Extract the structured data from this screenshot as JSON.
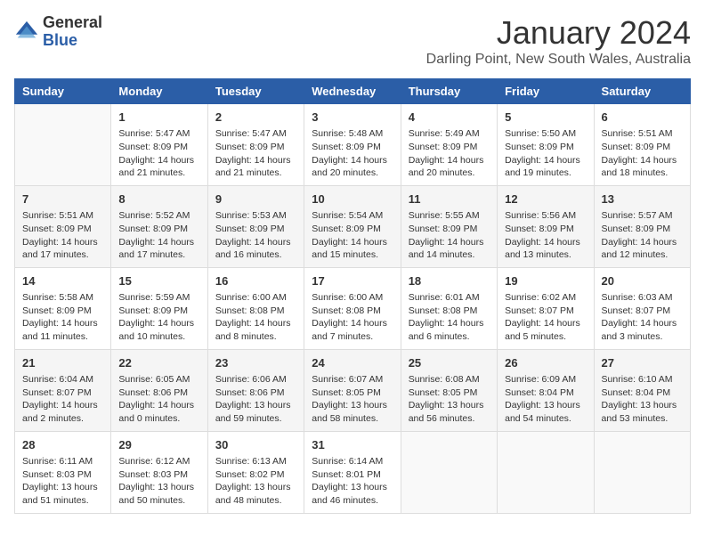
{
  "logo": {
    "general": "General",
    "blue": "Blue"
  },
  "title": "January 2024",
  "location": "Darling Point, New South Wales, Australia",
  "weekdays": [
    "Sunday",
    "Monday",
    "Tuesday",
    "Wednesday",
    "Thursday",
    "Friday",
    "Saturday"
  ],
  "weeks": [
    [
      {
        "day": "",
        "info": ""
      },
      {
        "day": "1",
        "info": "Sunrise: 5:47 AM\nSunset: 8:09 PM\nDaylight: 14 hours\nand 21 minutes."
      },
      {
        "day": "2",
        "info": "Sunrise: 5:47 AM\nSunset: 8:09 PM\nDaylight: 14 hours\nand 21 minutes."
      },
      {
        "day": "3",
        "info": "Sunrise: 5:48 AM\nSunset: 8:09 PM\nDaylight: 14 hours\nand 20 minutes."
      },
      {
        "day": "4",
        "info": "Sunrise: 5:49 AM\nSunset: 8:09 PM\nDaylight: 14 hours\nand 20 minutes."
      },
      {
        "day": "5",
        "info": "Sunrise: 5:50 AM\nSunset: 8:09 PM\nDaylight: 14 hours\nand 19 minutes."
      },
      {
        "day": "6",
        "info": "Sunrise: 5:51 AM\nSunset: 8:09 PM\nDaylight: 14 hours\nand 18 minutes."
      }
    ],
    [
      {
        "day": "7",
        "info": "Sunrise: 5:51 AM\nSunset: 8:09 PM\nDaylight: 14 hours\nand 17 minutes."
      },
      {
        "day": "8",
        "info": "Sunrise: 5:52 AM\nSunset: 8:09 PM\nDaylight: 14 hours\nand 17 minutes."
      },
      {
        "day": "9",
        "info": "Sunrise: 5:53 AM\nSunset: 8:09 PM\nDaylight: 14 hours\nand 16 minutes."
      },
      {
        "day": "10",
        "info": "Sunrise: 5:54 AM\nSunset: 8:09 PM\nDaylight: 14 hours\nand 15 minutes."
      },
      {
        "day": "11",
        "info": "Sunrise: 5:55 AM\nSunset: 8:09 PM\nDaylight: 14 hours\nand 14 minutes."
      },
      {
        "day": "12",
        "info": "Sunrise: 5:56 AM\nSunset: 8:09 PM\nDaylight: 14 hours\nand 13 minutes."
      },
      {
        "day": "13",
        "info": "Sunrise: 5:57 AM\nSunset: 8:09 PM\nDaylight: 14 hours\nand 12 minutes."
      }
    ],
    [
      {
        "day": "14",
        "info": "Sunrise: 5:58 AM\nSunset: 8:09 PM\nDaylight: 14 hours\nand 11 minutes."
      },
      {
        "day": "15",
        "info": "Sunrise: 5:59 AM\nSunset: 8:09 PM\nDaylight: 14 hours\nand 10 minutes."
      },
      {
        "day": "16",
        "info": "Sunrise: 6:00 AM\nSunset: 8:08 PM\nDaylight: 14 hours\nand 8 minutes."
      },
      {
        "day": "17",
        "info": "Sunrise: 6:00 AM\nSunset: 8:08 PM\nDaylight: 14 hours\nand 7 minutes."
      },
      {
        "day": "18",
        "info": "Sunrise: 6:01 AM\nSunset: 8:08 PM\nDaylight: 14 hours\nand 6 minutes."
      },
      {
        "day": "19",
        "info": "Sunrise: 6:02 AM\nSunset: 8:07 PM\nDaylight: 14 hours\nand 5 minutes."
      },
      {
        "day": "20",
        "info": "Sunrise: 6:03 AM\nSunset: 8:07 PM\nDaylight: 14 hours\nand 3 minutes."
      }
    ],
    [
      {
        "day": "21",
        "info": "Sunrise: 6:04 AM\nSunset: 8:07 PM\nDaylight: 14 hours\nand 2 minutes."
      },
      {
        "day": "22",
        "info": "Sunrise: 6:05 AM\nSunset: 8:06 PM\nDaylight: 14 hours\nand 0 minutes."
      },
      {
        "day": "23",
        "info": "Sunrise: 6:06 AM\nSunset: 8:06 PM\nDaylight: 13 hours\nand 59 minutes."
      },
      {
        "day": "24",
        "info": "Sunrise: 6:07 AM\nSunset: 8:05 PM\nDaylight: 13 hours\nand 58 minutes."
      },
      {
        "day": "25",
        "info": "Sunrise: 6:08 AM\nSunset: 8:05 PM\nDaylight: 13 hours\nand 56 minutes."
      },
      {
        "day": "26",
        "info": "Sunrise: 6:09 AM\nSunset: 8:04 PM\nDaylight: 13 hours\nand 54 minutes."
      },
      {
        "day": "27",
        "info": "Sunrise: 6:10 AM\nSunset: 8:04 PM\nDaylight: 13 hours\nand 53 minutes."
      }
    ],
    [
      {
        "day": "28",
        "info": "Sunrise: 6:11 AM\nSunset: 8:03 PM\nDaylight: 13 hours\nand 51 minutes."
      },
      {
        "day": "29",
        "info": "Sunrise: 6:12 AM\nSunset: 8:03 PM\nDaylight: 13 hours\nand 50 minutes."
      },
      {
        "day": "30",
        "info": "Sunrise: 6:13 AM\nSunset: 8:02 PM\nDaylight: 13 hours\nand 48 minutes."
      },
      {
        "day": "31",
        "info": "Sunrise: 6:14 AM\nSunset: 8:01 PM\nDaylight: 13 hours\nand 46 minutes."
      },
      {
        "day": "",
        "info": ""
      },
      {
        "day": "",
        "info": ""
      },
      {
        "day": "",
        "info": ""
      }
    ]
  ]
}
